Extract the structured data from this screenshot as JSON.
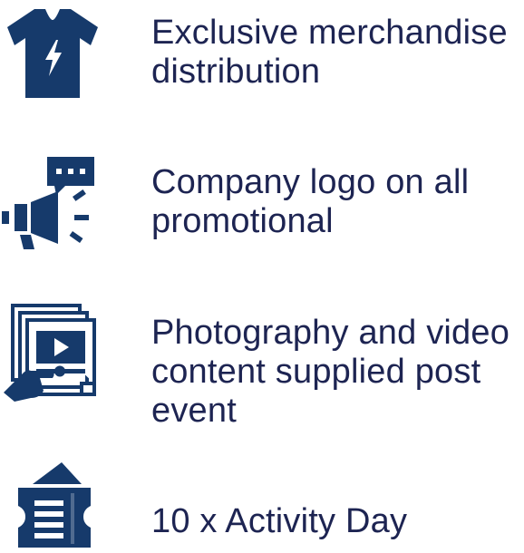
{
  "colors": {
    "icon": "#163a6b",
    "text": "#1d2452"
  },
  "benefits": [
    {
      "icon": "t-shirt-icon",
      "lines": [
        "Exclusive merchandise",
        "distribution"
      ]
    },
    {
      "icon": "megaphone-icon",
      "lines": [
        "Company logo on all",
        "promotional"
      ]
    },
    {
      "icon": "photo-video-icon",
      "lines": [
        "Photography and video",
        "content supplied post",
        "event"
      ]
    },
    {
      "icon": "ticket-icon",
      "lines": [
        "10 x Activity Day"
      ]
    }
  ]
}
